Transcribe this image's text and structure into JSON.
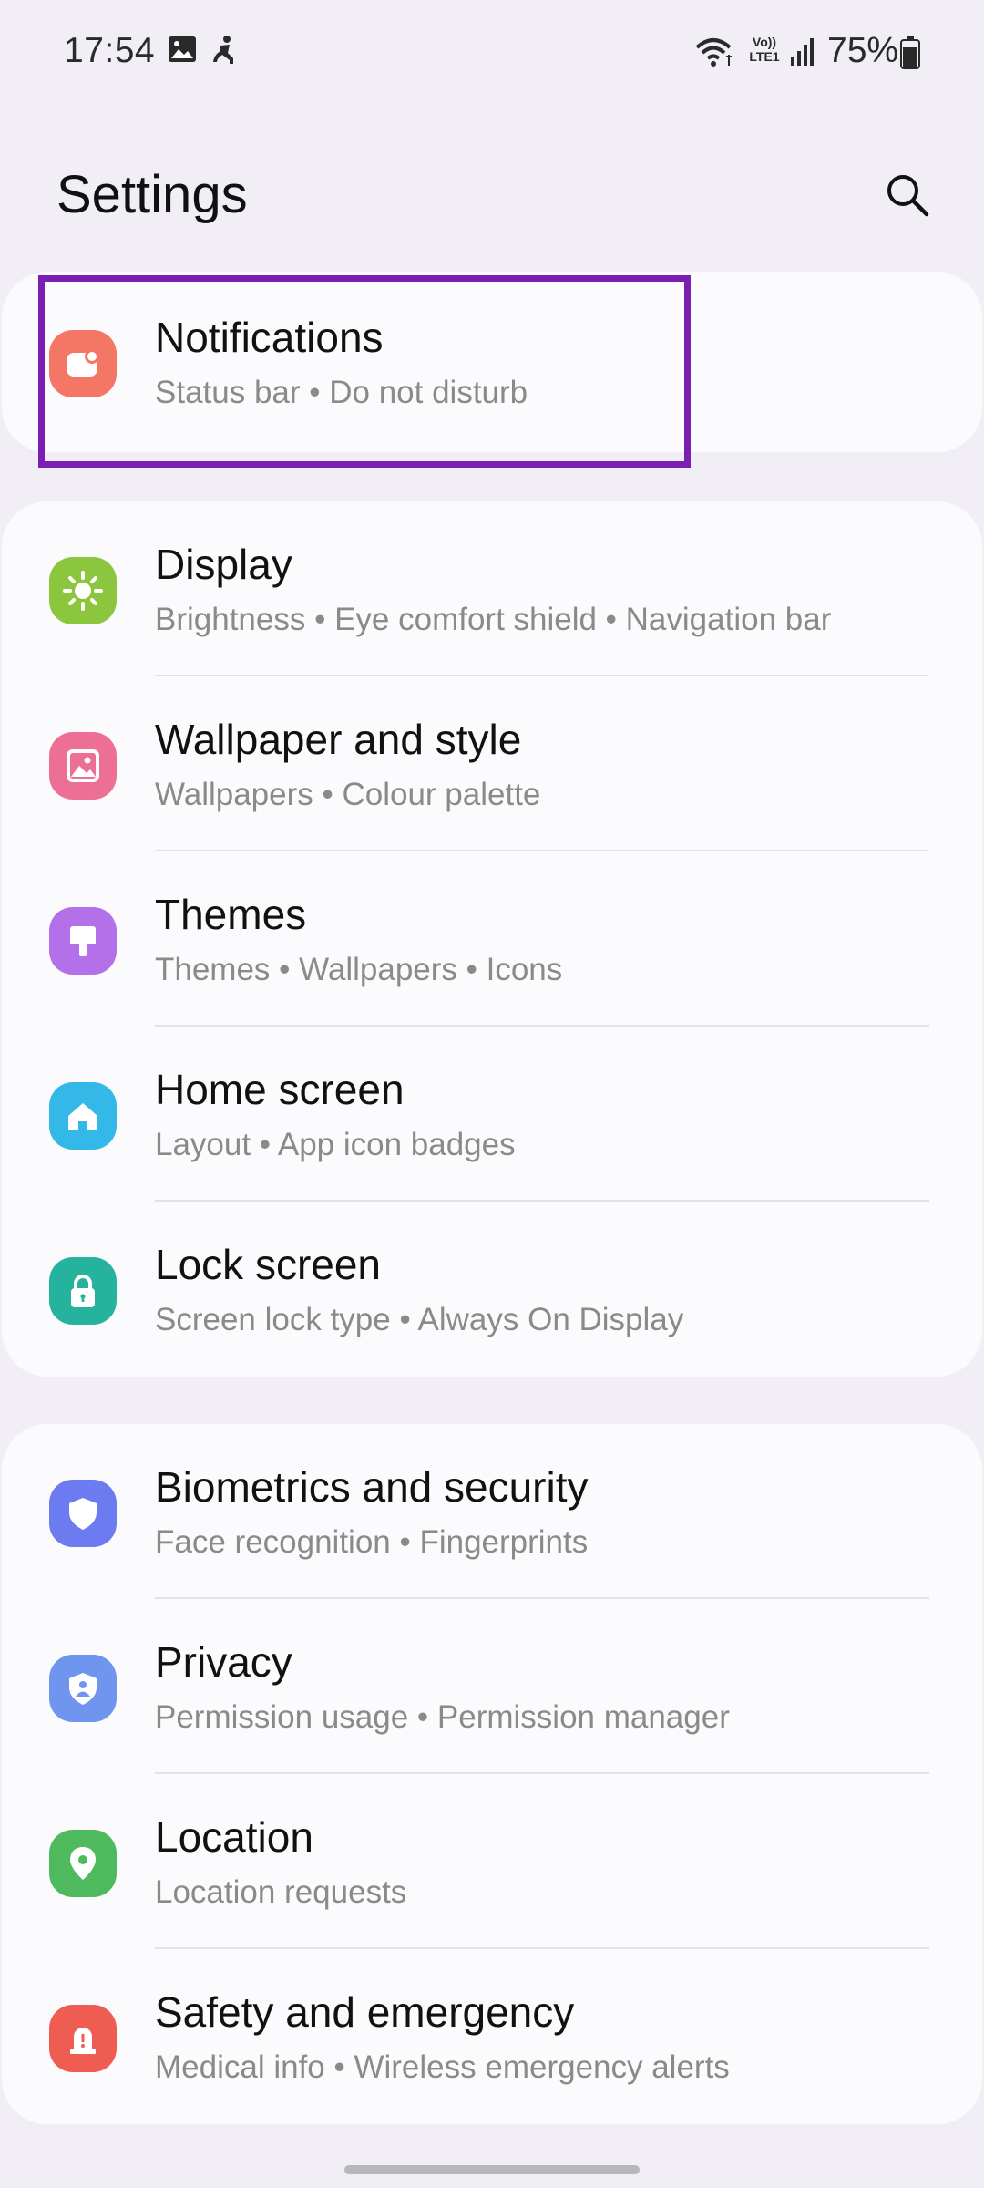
{
  "status_bar": {
    "time": "17:54",
    "battery": "75%",
    "icons": [
      "gallery-icon",
      "accessibility-icon",
      "wifi-icon",
      "volte-lte-icon",
      "signal-icon",
      "battery-icon"
    ],
    "volte_top": "Vo))",
    "volte_bottom": "LTE1"
  },
  "header": {
    "title": "Settings",
    "search_icon": "search-icon"
  },
  "sections": [
    {
      "items": [
        {
          "title": "Notifications",
          "subtitle": "Status bar  •  Do not disturb",
          "icon": "notifications-icon",
          "color": "#f47766",
          "highlighted": true
        }
      ]
    },
    {
      "items": [
        {
          "title": "Display",
          "subtitle": "Brightness  •  Eye comfort shield  •  Navigation bar",
          "icon": "display-sun-icon",
          "color": "#8cc63f"
        },
        {
          "title": "Wallpaper and style",
          "subtitle": "Wallpapers  •  Colour palette",
          "icon": "wallpaper-icon",
          "color": "#ee6f95"
        },
        {
          "title": "Themes",
          "subtitle": "Themes  •  Wallpapers  •  Icons",
          "icon": "themes-brush-icon",
          "color": "#b370e8"
        },
        {
          "title": "Home screen",
          "subtitle": "Layout  •  App icon badges",
          "icon": "home-icon",
          "color": "#33b8e8"
        },
        {
          "title": "Lock screen",
          "subtitle": "Screen lock type  •  Always On Display",
          "icon": "lock-icon",
          "color": "#26b39d"
        }
      ]
    },
    {
      "items": [
        {
          "title": "Biometrics and security",
          "subtitle": "Face recognition  •  Fingerprints",
          "icon": "shield-icon",
          "color": "#6d7bf0"
        },
        {
          "title": "Privacy",
          "subtitle": "Permission usage  •  Permission manager",
          "icon": "privacy-shield-icon",
          "color": "#6f95ee"
        },
        {
          "title": "Location",
          "subtitle": "Location requests",
          "icon": "location-pin-icon",
          "color": "#4fb95d"
        },
        {
          "title": "Safety and emergency",
          "subtitle": "Medical info  •  Wireless emergency alerts",
          "icon": "emergency-icon",
          "color": "#ee5c52"
        }
      ]
    }
  ]
}
